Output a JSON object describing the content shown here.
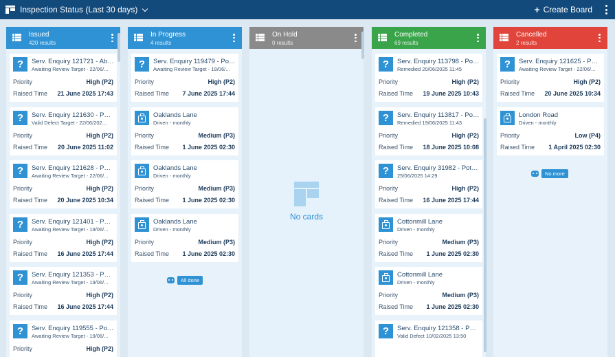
{
  "header": {
    "title": "Inspection Status (Last 30 days)",
    "create_label": "Create Board"
  },
  "columns": [
    {
      "title": "Issued",
      "count": "420 results",
      "color": "#2f92d4",
      "cards": [
        {
          "icon": "question",
          "title": "Serv. Enquiry 121721 - Aba...",
          "sub": "Awaiting Review Target - 22/06/...",
          "p_label": "Priority",
          "priority": "High (P2)",
          "t_label": "Raised Time",
          "time": "21 June 2025 17:43"
        },
        {
          "icon": "question",
          "title": "Serv. Enquiry 121630 - Pot ...",
          "sub": "Valid Defect Target - 22/06/202...",
          "p_label": "Priority",
          "priority": "High (P2)",
          "t_label": "Raised Time",
          "time": "20 June 2025 11:02"
        },
        {
          "icon": "question",
          "title": "Serv. Enquiry 121628 - Pot ...",
          "sub": "Awaiting Review Target - 22/06/...",
          "p_label": "Priority",
          "priority": "High (P2)",
          "t_label": "Raised Time",
          "time": "20 June 2025 10:34"
        },
        {
          "icon": "question",
          "title": "Serv. Enquiry 121401 - Pot ...",
          "sub": "Awaiting Review Target - 19/06/...",
          "p_label": "Priority",
          "priority": "High (P2)",
          "t_label": "Raised Time",
          "time": "16 June 2025 17:44"
        },
        {
          "icon": "question",
          "title": "Serv. Enquiry 121353 - Pot ...",
          "sub": "Awaiting Review Target - 19/06/...",
          "p_label": "Priority",
          "priority": "High (P2)",
          "t_label": "Raised Time",
          "time": "16 June 2025 17:44"
        },
        {
          "icon": "question",
          "title": "Serv. Enquiry 119555 - Pot ...",
          "sub": "Awaiting Review Target - 19/06/...",
          "p_label": "Priority",
          "priority": "High (P2)",
          "t_label": "",
          "time": ""
        }
      ]
    },
    {
      "title": "In Progress",
      "count": "4 results",
      "color": "#2f92d4",
      "cards": [
        {
          "icon": "question",
          "title": "Serv. Enquiry 119479 - Pot ...",
          "sub": "Awaiting Review Target - 19/06/...",
          "p_label": "Priority",
          "priority": "High (P2)",
          "t_label": "Raised Time",
          "time": "7 June 2025 17:44"
        },
        {
          "icon": "bag",
          "title": "Oaklands Lane",
          "sub": "Driven - monthly",
          "p_label": "Priority",
          "priority": "Medium (P3)",
          "t_label": "Raised Time",
          "time": "1 June 2025 02:30"
        },
        {
          "icon": "bag",
          "title": "Oaklands Lane",
          "sub": "Driven - monthly",
          "p_label": "Priority",
          "priority": "Medium (P3)",
          "t_label": "Raised Time",
          "time": "1 June 2025 02:30"
        },
        {
          "icon": "bag",
          "title": "Oaklands Lane",
          "sub": "Driven - monthly",
          "p_label": "Priority",
          "priority": "Medium (P3)",
          "t_label": "Raised Time",
          "time": "1 June 2025 02:30"
        }
      ],
      "end_label": "All done"
    },
    {
      "title": "On Hold",
      "count": "0 results",
      "color": "#8a8a8a",
      "cards": [],
      "empty_label": "No cards"
    },
    {
      "title": "Completed",
      "count": "69 results",
      "color": "#3aa44a",
      "cards": [
        {
          "icon": "question",
          "title": "Serv. Enquiry 113798 - Pot ...",
          "sub": "Remedied 20/06/2025 11:45",
          "p_label": "Priority",
          "priority": "High (P2)",
          "t_label": "Raised Time",
          "time": "19 June 2025 10:43"
        },
        {
          "icon": "question",
          "title": "Serv. Enquiry 113817 - Pot ...",
          "sub": "Remedied 19/06/2025 11:43",
          "p_label": "Priority",
          "priority": "High (P2)",
          "t_label": "Raised Time",
          "time": "18 June 2025 10:08"
        },
        {
          "icon": "question",
          "title": "Serv. Enquiry 31982 - Pot H...",
          "sub": "25/06/2025 14:29",
          "p_label": "Priority",
          "priority": "High (P2)",
          "t_label": "Raised Time",
          "time": "16 June 2025 17:44"
        },
        {
          "icon": "bag",
          "title": "Cottonmill Lane",
          "sub": "Driven - monthly",
          "p_label": "Priority",
          "priority": "Medium (P3)",
          "t_label": "Raised Time",
          "time": "1 June 2025 02:30"
        },
        {
          "icon": "bag",
          "title": "Cottonmill Lane",
          "sub": "Driven - monthly",
          "p_label": "Priority",
          "priority": "Medium (P3)",
          "t_label": "Raised Time",
          "time": "1 June 2025 02:30"
        },
        {
          "icon": "question",
          "title": "Serv. Enquiry 121358 - Pot ...",
          "sub": "Valid Defect 10/02/2025 13:50",
          "p_label": "",
          "priority": "",
          "t_label": "",
          "time": ""
        }
      ]
    },
    {
      "title": "Cancelled",
      "count": "2 results",
      "color": "#e0443a",
      "cards": [
        {
          "icon": "question",
          "title": "Serv. Enquiry 121625 - Pot ...",
          "sub": "Awaiting Review Target - 22/06/...",
          "p_label": "Priority",
          "priority": "High (P2)",
          "t_label": "Raised Time",
          "time": "20 June 2025 10:34"
        },
        {
          "icon": "bag",
          "title": "London Road",
          "sub": "Driven - monthly",
          "p_label": "Priority",
          "priority": "Low (P4)",
          "t_label": "Raised Time",
          "time": "1 April 2025 02:30"
        }
      ],
      "end_label": "No more"
    }
  ],
  "icons": {
    "board": "board-icon",
    "create": "plus-icon",
    "menu": "more-vertical-icon",
    "column": "list-icon",
    "question": "question-icon",
    "bag": "briefcase-icon",
    "robot": "robot-icon",
    "empty": "board-placeholder-icon"
  }
}
